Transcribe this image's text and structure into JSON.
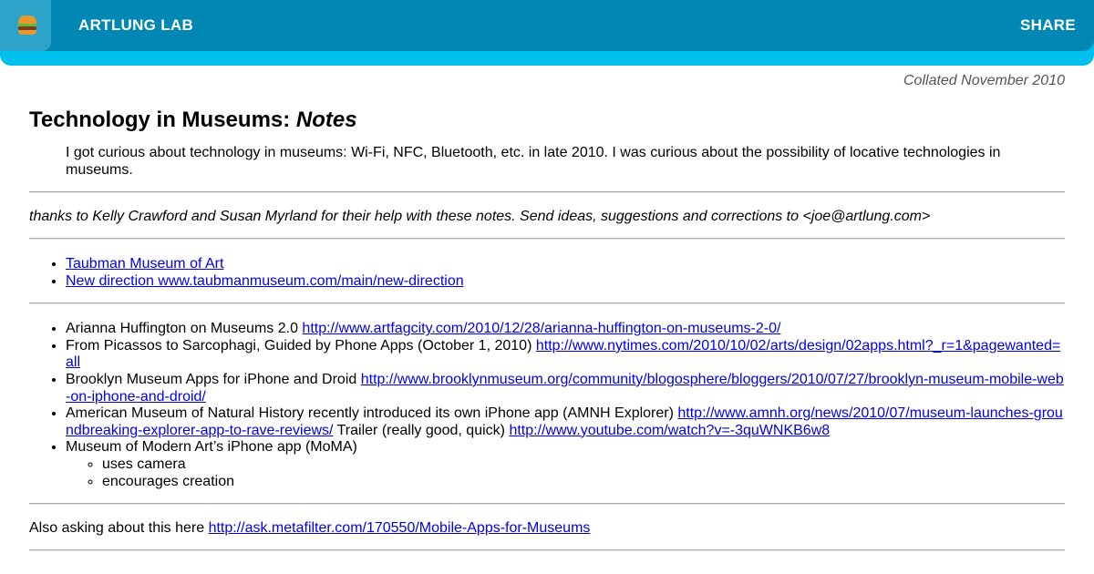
{
  "header": {
    "brand": "ARTLUNG LAB",
    "share_label": "SHARE",
    "menu_icon": "hamburger-emoji-icon"
  },
  "collated": "Collated November 2010",
  "page": {
    "title_main": "Technology in Museums:",
    "title_em": "Notes",
    "intro": "I got curious about technology in museums: Wi-Fi, NFC, Bluetooth, etc. in late 2010. I was curious about the possibility of locative technologies in museums.",
    "thanks": "thanks to Kelly Crawford and Susan Myrland for their help with these notes. Send ideas, suggestions and corrections to <joe@artlung.com>"
  },
  "links_group1": [
    {
      "text": "Taubman Museum of Art"
    },
    {
      "text": "New direction www.taubmanmuseum.com/main/new-direction"
    }
  ],
  "links_group2": [
    {
      "label": "Arianna Huffington on Museums 2.0 ",
      "link": "http://www.artfagcity.com/2010/12/28/arianna-huffington-on-museums-2-0/"
    },
    {
      "label": "From Picassos to Sarcophagi, Guided by Phone Apps (October 1, 2010) ",
      "link": "http://www.nytimes.com/2010/10/02/arts/design/02apps.html?_r=1&pagewanted=all"
    },
    {
      "label": "Brooklyn Museum Apps for iPhone and Droid ",
      "link": "http://www.brooklynmuseum.org/community/blogosphere/bloggers/2010/07/27/brooklyn-museum-mobile-web-on-iphone-and-droid/"
    },
    {
      "label": "American Museum of Natural History recently introduced its own iPhone app (AMNH Explorer) ",
      "link": "http://www.amnh.org/news/2010/07/museum-launches-groundbreaking-explorer-app-to-rave-reviews/",
      "label2": " Trailer (really good, quick) ",
      "link2": "http://www.youtube.com/watch?v=-3quWNKB6w8"
    },
    {
      "label": "Museum of Modern Art’s iPhone app (MoMA)",
      "sub": [
        "uses camera",
        "encourages creation"
      ]
    }
  ],
  "asking": {
    "label": "Also asking about this here ",
    "link": "http://ask.metafilter.com/170550/Mobile-Apps-for-Museums"
  },
  "colors": {
    "header_dark": "#0087b3",
    "header_light": "#00c0ee",
    "link": "#0000ee"
  }
}
